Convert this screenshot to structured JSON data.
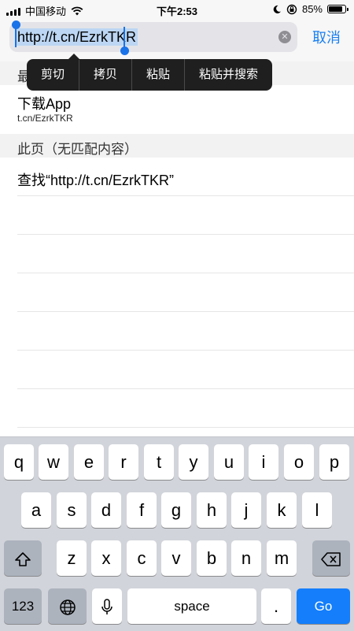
{
  "status_bar": {
    "carrier": "中国移动",
    "time": "下午2:53",
    "battery_text": "85%",
    "battery_level": 0.85,
    "icons": [
      "signal-icon",
      "wifi-icon",
      "moon-icon",
      "rotation-lock-icon",
      "battery-icon"
    ]
  },
  "address_bar": {
    "url": "http://t.cn/EzrkTKR",
    "cancel_label": "取消"
  },
  "context_menu": {
    "items": [
      "剪切",
      "拷贝",
      "粘贴",
      "粘贴并搜索"
    ]
  },
  "sections": {
    "recent_header_visible": "最",
    "result_title": "下载App",
    "result_subtitle": "t.cn/EzrkTKR",
    "on_page_header": "此页（无匹配内容）",
    "find_label": "查找“http://t.cn/EzrkTKR”"
  },
  "keyboard": {
    "row1": [
      "q",
      "w",
      "e",
      "r",
      "t",
      "y",
      "u",
      "i",
      "o",
      "p"
    ],
    "row2": [
      "a",
      "s",
      "d",
      "f",
      "g",
      "h",
      "j",
      "k",
      "l"
    ],
    "row3": [
      "z",
      "x",
      "c",
      "v",
      "b",
      "n",
      "m"
    ],
    "numbers_label": "123",
    "space_label": "space",
    "period_label": ".",
    "go_label": "Go"
  },
  "colors": {
    "accent": "#1a7ff0",
    "selection": "#bcd6f3",
    "menu_bg": "#1f1f1f",
    "go_key": "#147efb"
  }
}
